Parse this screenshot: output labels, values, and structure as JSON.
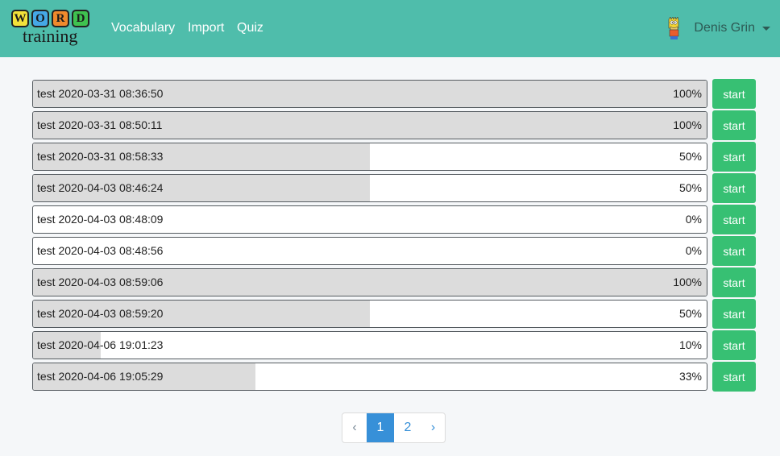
{
  "header": {
    "logo": {
      "tiles": [
        {
          "letter": "W",
          "color": "#f3e23a"
        },
        {
          "letter": "O",
          "color": "#45a8e6"
        },
        {
          "letter": "R",
          "color": "#f08a2c"
        },
        {
          "letter": "D",
          "color": "#3fc24f"
        }
      ],
      "word": "training"
    },
    "nav": [
      "Vocabulary",
      "Import",
      "Quiz"
    ],
    "user": {
      "name": "Denis Grin",
      "avatar_icon": "bart-simpson-avatar-icon",
      "dropdown_icon": "caret-down-icon"
    },
    "bg_color": "#4fbdab"
  },
  "tests": [
    {
      "name": "test 2020-03-31 08:36:50",
      "progress": 100,
      "progress_label": "100%",
      "button": "start"
    },
    {
      "name": "test 2020-03-31 08:50:11",
      "progress": 100,
      "progress_label": "100%",
      "button": "start"
    },
    {
      "name": "test 2020-03-31 08:58:33",
      "progress": 50,
      "progress_label": "50%",
      "button": "start"
    },
    {
      "name": "test 2020-04-03 08:46:24",
      "progress": 50,
      "progress_label": "50%",
      "button": "start"
    },
    {
      "name": "test 2020-04-03 08:48:09",
      "progress": 0,
      "progress_label": "0%",
      "button": "start"
    },
    {
      "name": "test 2020-04-03 08:48:56",
      "progress": 0,
      "progress_label": "0%",
      "button": "start"
    },
    {
      "name": "test 2020-04-03 08:59:06",
      "progress": 100,
      "progress_label": "100%",
      "button": "start"
    },
    {
      "name": "test 2020-04-03 08:59:20",
      "progress": 50,
      "progress_label": "50%",
      "button": "start"
    },
    {
      "name": "test 2020-04-06 19:01:23",
      "progress": 10,
      "progress_label": "10%",
      "button": "start"
    },
    {
      "name": "test 2020-04-06 19:05:29",
      "progress": 33,
      "progress_label": "33%",
      "button": "start"
    }
  ],
  "pagination": {
    "prev": "‹",
    "pages": [
      "1",
      "2"
    ],
    "current": "1",
    "next": "›"
  },
  "colors": {
    "start_button": "#37c073",
    "progress_fill": "#dcdcdc",
    "active_page": "#3790d8"
  }
}
